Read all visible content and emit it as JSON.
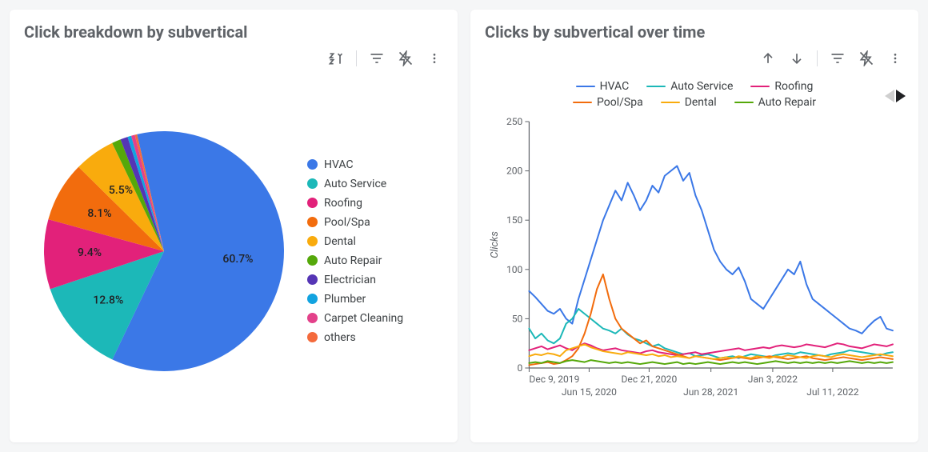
{
  "left_card": {
    "title": "Click breakdown by subvertical",
    "legend": [
      "HVAC",
      "Auto Service",
      "Roofing",
      "Pool/Spa",
      "Dental",
      "Auto Repair",
      "Electrician",
      "Plumber",
      "Carpet Cleaning",
      "others"
    ]
  },
  "right_card": {
    "title": "Clicks by subvertical over time",
    "y_title": "Clicks",
    "legend": [
      "HVAC",
      "Auto Service",
      "Roofing",
      "Pool/Spa",
      "Dental",
      "Auto Repair"
    ],
    "x_ticks_top": [
      "Dec 9, 2019",
      "Dec 21, 2020",
      "Jan 3, 2022"
    ],
    "x_ticks_bot": [
      "Jun 15, 2020",
      "Jun 28, 2021",
      "Jul 11, 2022"
    ],
    "y_ticks": [
      "0",
      "50",
      "100",
      "150",
      "200",
      "250"
    ]
  },
  "colors": {
    "HVAC": "#3b78e7",
    "Auto Service": "#1cb8b8",
    "Roofing": "#e2217a",
    "Pool/Spa": "#f26c0d",
    "Dental": "#f9ab0d",
    "Auto Repair": "#55a80a",
    "Electrician": "#5535b5",
    "Plumber": "#12a3e0",
    "Carpet Cleaning": "#e3418a",
    "others": "#f46a3c"
  },
  "chart_data": [
    {
      "type": "pie",
      "title": "Click breakdown by subvertical",
      "slices": [
        {
          "label": "HVAC",
          "value": 60.7,
          "show_label": true
        },
        {
          "label": "Auto Service",
          "value": 12.8,
          "show_label": true
        },
        {
          "label": "Roofing",
          "value": 9.4,
          "show_label": true
        },
        {
          "label": "Pool/Spa",
          "value": 8.1,
          "show_label": true
        },
        {
          "label": "Dental",
          "value": 5.5,
          "show_label": true
        },
        {
          "label": "Auto Repair",
          "value": 1.2,
          "show_label": false
        },
        {
          "label": "Electrician",
          "value": 1.0,
          "show_label": false
        },
        {
          "label": "Plumber",
          "value": 0.5,
          "show_label": false
        },
        {
          "label": "Carpet Cleaning",
          "value": 0.5,
          "show_label": false
        },
        {
          "label": "others",
          "value": 0.3,
          "show_label": false
        }
      ]
    },
    {
      "type": "line",
      "title": "Clicks by subvertical over time",
      "xlabel": "",
      "ylabel": "Clicks",
      "ylim": [
        0,
        250
      ],
      "x_dates": [
        "Dec 9, 2019",
        "Jun 15, 2020",
        "Dec 21, 2020",
        "Jun 28, 2021",
        "Jan 3, 2022",
        "Jul 11, 2022"
      ],
      "n_points": 60,
      "series": [
        {
          "name": "HVAC",
          "values": [
            78,
            72,
            65,
            58,
            55,
            60,
            50,
            45,
            70,
            90,
            110,
            130,
            150,
            165,
            180,
            170,
            188,
            175,
            160,
            170,
            185,
            178,
            195,
            200,
            205,
            190,
            198,
            175,
            160,
            140,
            120,
            108,
            100,
            95,
            102,
            88,
            70,
            65,
            60,
            70,
            80,
            90,
            100,
            95,
            108,
            85,
            70,
            65,
            60,
            55,
            50,
            45,
            40,
            38,
            35,
            42,
            48,
            52,
            40,
            38
          ]
        },
        {
          "name": "Auto Service",
          "values": [
            40,
            30,
            35,
            28,
            25,
            30,
            45,
            50,
            60,
            55,
            50,
            45,
            40,
            38,
            35,
            40,
            34,
            30,
            28,
            25,
            22,
            24,
            20,
            18,
            16,
            14,
            15,
            12,
            13,
            14,
            12,
            10,
            11,
            12,
            10,
            12,
            14,
            13,
            12,
            11,
            13,
            14,
            15,
            14,
            16,
            15,
            14,
            13,
            12,
            14,
            15,
            16,
            18,
            17,
            16,
            15,
            14,
            13,
            15,
            16
          ]
        },
        {
          "name": "Roofing",
          "values": [
            18,
            20,
            22,
            19,
            21,
            23,
            20,
            18,
            22,
            25,
            23,
            20,
            18,
            19,
            20,
            18,
            17,
            16,
            15,
            17,
            18,
            16,
            15,
            14,
            13,
            14,
            15,
            16,
            14,
            15,
            16,
            17,
            18,
            19,
            20,
            18,
            19,
            20,
            21,
            20,
            22,
            23,
            22,
            21,
            22,
            24,
            23,
            22,
            21,
            23,
            25,
            24,
            22,
            21,
            20,
            22,
            24,
            23,
            22,
            24
          ]
        },
        {
          "name": "Pool/Spa",
          "values": [
            3,
            4,
            5,
            6,
            4,
            5,
            8,
            12,
            20,
            35,
            55,
            80,
            95,
            70,
            50,
            40,
            35,
            30,
            25,
            28,
            22,
            20,
            18,
            16,
            14,
            12,
            10,
            12,
            11,
            10,
            9,
            8,
            9,
            10,
            11,
            10,
            9,
            10,
            11,
            12,
            11,
            10,
            9,
            10,
            11,
            12,
            10,
            9,
            8,
            9,
            10,
            11,
            10,
            9,
            8,
            9,
            10,
            11,
            10,
            9
          ]
        },
        {
          "name": "Dental",
          "values": [
            12,
            14,
            13,
            15,
            14,
            12,
            18,
            20,
            22,
            24,
            21,
            19,
            17,
            16,
            15,
            14,
            16,
            15,
            14,
            13,
            14,
            12,
            13,
            11,
            12,
            11,
            10,
            12,
            11,
            10,
            9,
            10,
            11,
            10,
            12,
            11,
            10,
            12,
            11,
            10,
            12,
            11,
            13,
            12,
            11,
            10,
            12,
            13,
            12,
            11,
            13,
            14,
            13,
            12,
            11,
            12,
            13,
            14,
            13,
            12
          ]
        },
        {
          "name": "Auto Repair",
          "values": [
            5,
            6,
            5,
            7,
            6,
            5,
            7,
            8,
            7,
            6,
            8,
            7,
            6,
            5,
            6,
            5,
            6,
            5,
            4,
            5,
            6,
            5,
            4,
            5,
            6,
            4,
            5,
            4,
            5,
            6,
            5,
            4,
            5,
            6,
            5,
            6,
            5,
            4,
            5,
            6,
            7,
            6,
            5,
            6,
            5,
            6,
            5,
            6,
            5,
            6,
            5,
            6,
            7,
            6,
            5,
            6,
            5,
            6,
            5,
            6
          ]
        }
      ]
    }
  ]
}
